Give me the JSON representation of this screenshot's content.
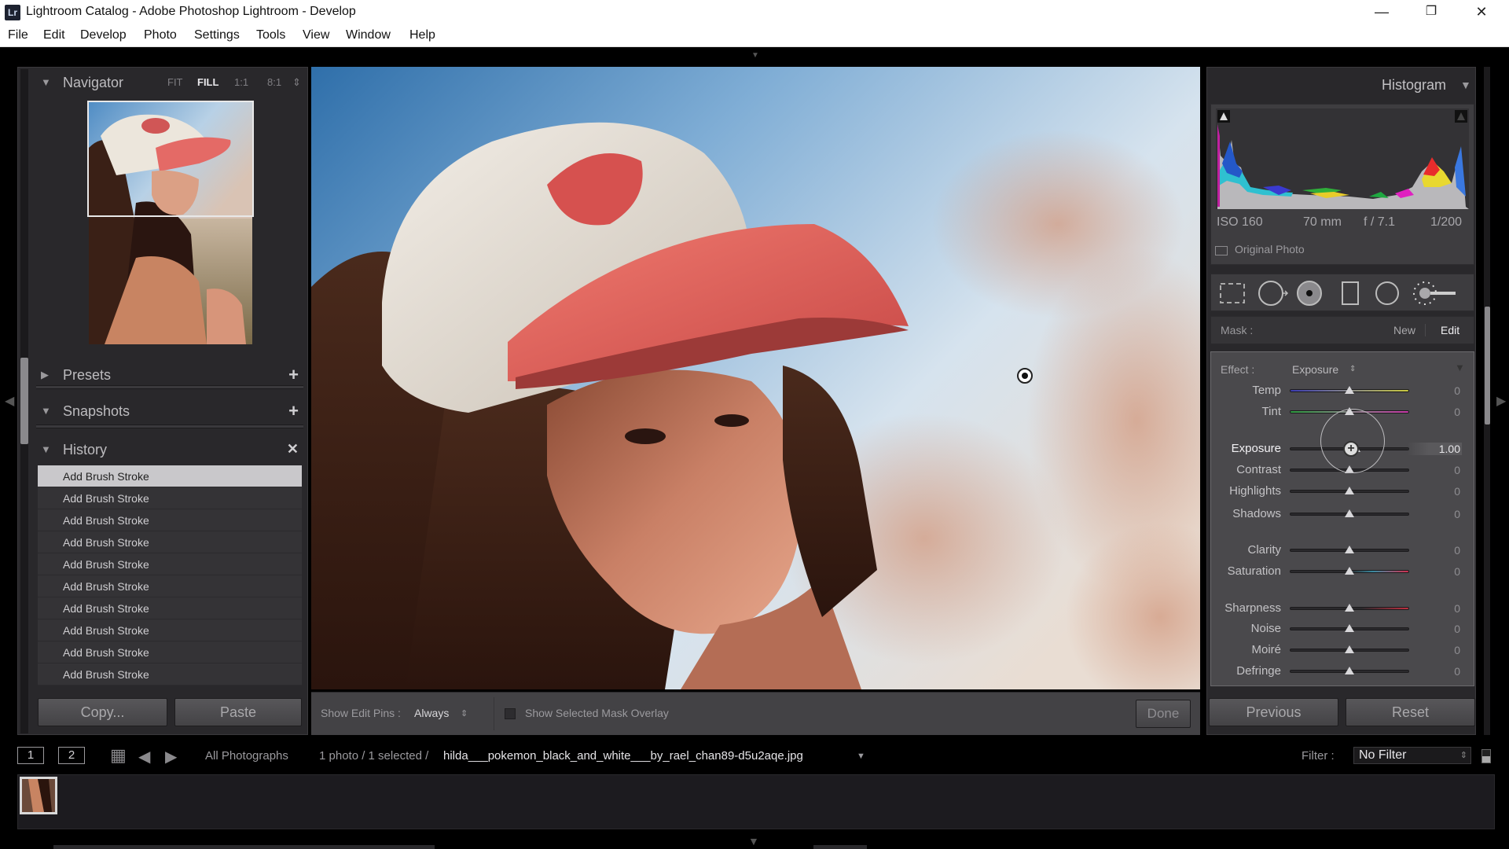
{
  "window": {
    "app_icon": "Lr",
    "title": "Lightroom Catalog - Adobe Photoshop Lightroom - Develop",
    "controls": {
      "minimize": "—",
      "restore": "❐",
      "close": "✕"
    }
  },
  "menu": [
    "File",
    "Edit",
    "Develop",
    "Photo",
    "Settings",
    "Tools",
    "View",
    "Window",
    "Help"
  ],
  "left_panel": {
    "navigator": {
      "title": "Navigator",
      "zoom_options": [
        "FIT",
        "FILL",
        "1:1",
        "8:1"
      ],
      "active_zoom": "FILL",
      "stepper_icon": "⇕"
    },
    "presets": {
      "title": "Presets",
      "action": "+"
    },
    "snapshots": {
      "title": "Snapshots",
      "action": "+"
    },
    "history": {
      "title": "History",
      "action": "✕",
      "items": [
        "Add Brush Stroke",
        "Add Brush Stroke",
        "Add Brush Stroke",
        "Add Brush Stroke",
        "Add Brush Stroke",
        "Add Brush Stroke",
        "Add Brush Stroke",
        "Add Brush Stroke",
        "Add Brush Stroke",
        "Add Brush Stroke"
      ],
      "selected_index": 0
    },
    "buttons": {
      "copy": "Copy...",
      "paste": "Paste"
    }
  },
  "toolbar": {
    "show_edit_pins_label": "Show Edit Pins :",
    "show_edit_pins_value": "Always",
    "show_mask_overlay_label": "Show Selected Mask Overlay",
    "show_mask_overlay_checked": false,
    "done": "Done"
  },
  "right_panel": {
    "histogram": {
      "title": "Histogram",
      "exif": {
        "iso": "ISO 160",
        "focal": "70 mm",
        "aperture": "f / 7.1",
        "shutter": "1/200"
      },
      "original_photo_label": "Original Photo",
      "original_photo_checked": false
    },
    "tools": [
      "crop-overlay",
      "spot-removal",
      "red-eye",
      "graduated-filter",
      "radial-filter",
      "adjustment-brush"
    ],
    "mask": {
      "label": "Mask :",
      "new": "New",
      "edit": "Edit"
    },
    "effect": {
      "label": "Effect :",
      "value": "Exposure",
      "sliders": [
        {
          "name": "Temp",
          "value": "0",
          "position": 0.5
        },
        {
          "name": "Tint",
          "value": "0",
          "position": 0.5
        },
        {
          "name": "Exposure",
          "value": "1.00",
          "position": 0.55
        },
        {
          "name": "Contrast",
          "value": "0",
          "position": 0.5
        },
        {
          "name": "Highlights",
          "value": "0",
          "position": 0.5
        },
        {
          "name": "Shadows",
          "value": "0",
          "position": 0.5
        },
        {
          "name": "Clarity",
          "value": "0",
          "position": 0.5
        },
        {
          "name": "Saturation",
          "value": "0",
          "position": 0.5
        },
        {
          "name": "Sharpness",
          "value": "0",
          "position": 0.5
        },
        {
          "name": "Noise",
          "value": "0",
          "position": 0.5
        },
        {
          "name": "Moiré",
          "value": "0",
          "position": 0.5
        },
        {
          "name": "Defringe",
          "value": "0",
          "position": 0.5
        }
      ]
    },
    "buttons": {
      "previous": "Previous",
      "reset": "Reset"
    }
  },
  "filmstrip": {
    "view_buttons": [
      "1",
      "2"
    ],
    "source": "All Photographs",
    "count": "1 photo / 1 selected /",
    "filename": "hilda___pokemon_black_and_white___by_rael_chan89-d5u2aqe.jpg",
    "filter_label": "Filter :",
    "filter_value": "No Filter"
  }
}
